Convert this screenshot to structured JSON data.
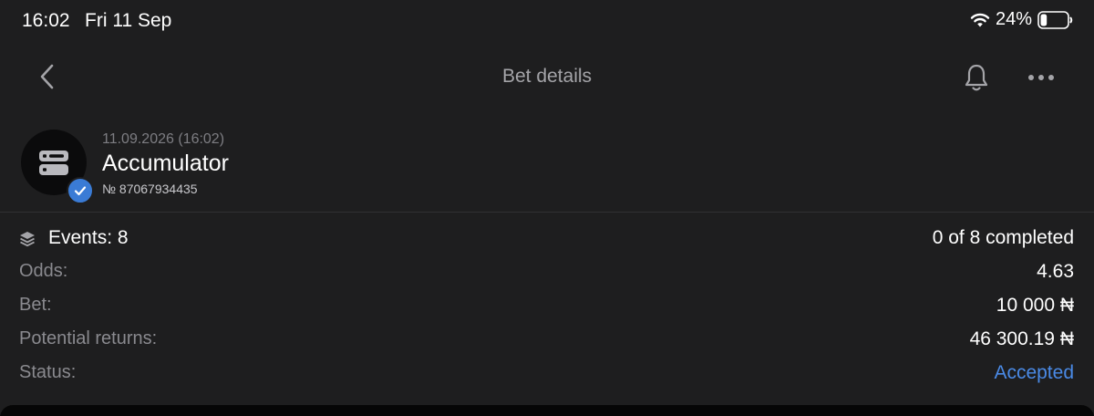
{
  "status_bar": {
    "time": "16:02",
    "date": "Fri 11 Sep",
    "battery_percent": "24%",
    "battery_level": 0.24,
    "wifi_icon": "wifi-icon",
    "battery_icon": "battery-icon"
  },
  "nav": {
    "title": "Bet details",
    "back_icon": "chevron-left-icon",
    "bell_icon": "bell-icon",
    "more_icon": "more-horizontal-icon"
  },
  "bet": {
    "datetime": "11.09.2026 (16:02)",
    "type": "Accumulator",
    "number": "№ 87067934435",
    "avatar_icon": "bet-slip-icon",
    "badge_icon": "check-badge-icon"
  },
  "details": {
    "events": {
      "icon": "layers-icon",
      "label": "Events: 8",
      "value": "0 of 8 completed"
    },
    "odds": {
      "label": "Odds:",
      "value": "4.63"
    },
    "bet": {
      "label": "Bet:",
      "value": "10 000 ₦"
    },
    "potential_returns": {
      "label": "Potential returns:",
      "value": "46 300.19 ₦"
    },
    "status": {
      "label": "Status:",
      "value": "Accepted"
    }
  },
  "colors": {
    "background": "#1e1e1f",
    "accent": "#4a8ae6",
    "badge": "#3a7bd5",
    "muted_text": "#8a8a8f"
  }
}
